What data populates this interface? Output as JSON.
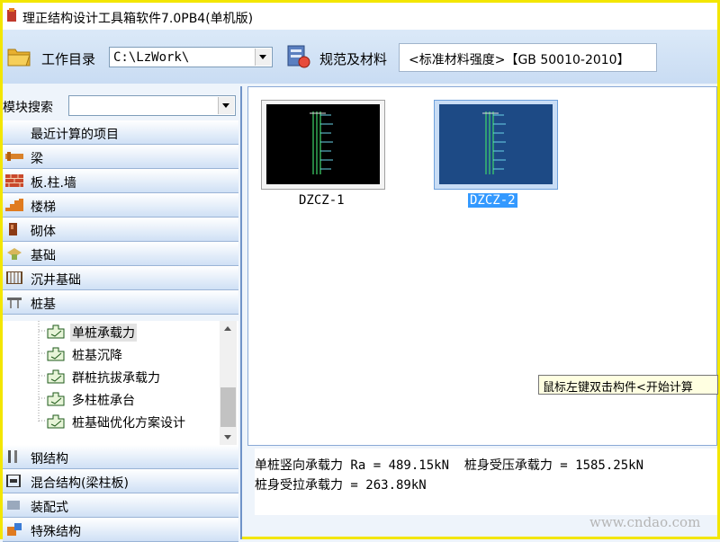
{
  "window": {
    "title": "理正结构设计工具箱软件7.0PB4(单机版)"
  },
  "toolbar": {
    "workdir_label": "工作目录",
    "workdir_value": "C:\\LzWork\\",
    "spec_label": "规范及材料",
    "spec_value": "<标准材料强度>【GB 50010-2010】"
  },
  "sidebar": {
    "search_label": "模块搜索",
    "search_value": "",
    "recent_label": "最近计算的项目",
    "categories_top": [
      {
        "label": "梁",
        "icon": "beam-icon"
      },
      {
        "label": "板.柱.墙",
        "icon": "brick-wall-icon"
      },
      {
        "label": "楼梯",
        "icon": "stair-icon"
      },
      {
        "label": "砌体",
        "icon": "masonry-icon"
      },
      {
        "label": "基础",
        "icon": "foundation-icon"
      },
      {
        "label": "沉井基础",
        "icon": "caisson-icon"
      },
      {
        "label": "桩基",
        "icon": "pile-icon"
      }
    ],
    "pile_tree": [
      {
        "label": "单桩承载力",
        "selected": true
      },
      {
        "label": "桩基沉降",
        "selected": false
      },
      {
        "label": "群桩抗拔承载力",
        "selected": false
      },
      {
        "label": "多柱桩承台",
        "selected": false
      },
      {
        "label": "桩基础优化方案设计",
        "selected": false
      }
    ],
    "categories_bottom": [
      {
        "label": "钢结构",
        "icon": "steel-icon"
      },
      {
        "label": "混合结构(梁柱板)",
        "icon": "composite-icon"
      },
      {
        "label": "装配式",
        "icon": "prefab-icon"
      },
      {
        "label": "特殊结构",
        "icon": "special-icon"
      }
    ]
  },
  "main": {
    "items": [
      {
        "caption": "DZCZ-1",
        "selected": false
      },
      {
        "caption": "DZCZ-2",
        "selected": true
      }
    ],
    "tooltip": "鼠标左键双击构件<开始计算"
  },
  "output": {
    "line1": "单桩竖向承载力 Ra = 489.15kN  桩身受压承载力 = 1585.25kN",
    "line2": "桩身受拉承载力 = 263.89kN"
  },
  "watermark": "www.cndao.com",
  "colors": {
    "accent": "#3399ff",
    "frame": "#f3e600",
    "thumb_bg_selected": "#1d4a85"
  }
}
